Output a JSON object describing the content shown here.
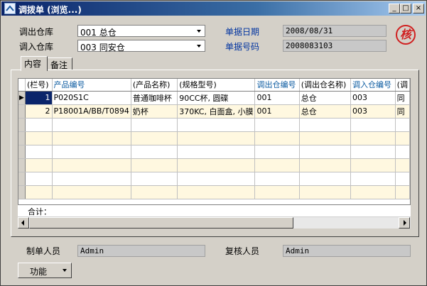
{
  "window": {
    "title": "调拨单 (浏览...)",
    "buttons": {
      "minimize": "_",
      "maximize": "□",
      "close": "×"
    }
  },
  "form": {
    "out_warehouse_label": "调出仓库",
    "out_warehouse_value": "001 总仓",
    "in_warehouse_label": "调入仓库",
    "in_warehouse_value": "003 同安仓",
    "date_label": "单据日期",
    "date_value": "2008/08/31",
    "number_label": "单据号码",
    "number_value": "2008083103",
    "stamp": "核"
  },
  "tabs": [
    {
      "label": "内容"
    },
    {
      "label": "备注"
    }
  ],
  "grid": {
    "columns": [
      "(栏号)",
      "产品编号",
      "(产品名称)",
      "(规格型号)",
      "调出仓编号",
      "(调出仓名称)",
      "调入仓编号",
      "(调"
    ],
    "rows": [
      [
        "1",
        "P020S1C",
        "普通咖啡杯",
        "90CC杯, 圆碟",
        "001",
        "总仓",
        "003",
        "同"
      ],
      [
        "2",
        "P18001A/BB/T0894",
        "奶杯",
        "370KC, 白面盒, 小膜",
        "001",
        "总仓",
        "003",
        "同"
      ]
    ],
    "sum_label": "合计："
  },
  "footer": {
    "maker_label": "制单人员",
    "maker_value": "Admin",
    "reviewer_label": "复核人员",
    "reviewer_value": "Admin",
    "function_button": "功能"
  },
  "colors": {
    "header_blue": "#0a5aa0",
    "label_blue": "#0033a0",
    "stripe": "#fff8e0"
  }
}
